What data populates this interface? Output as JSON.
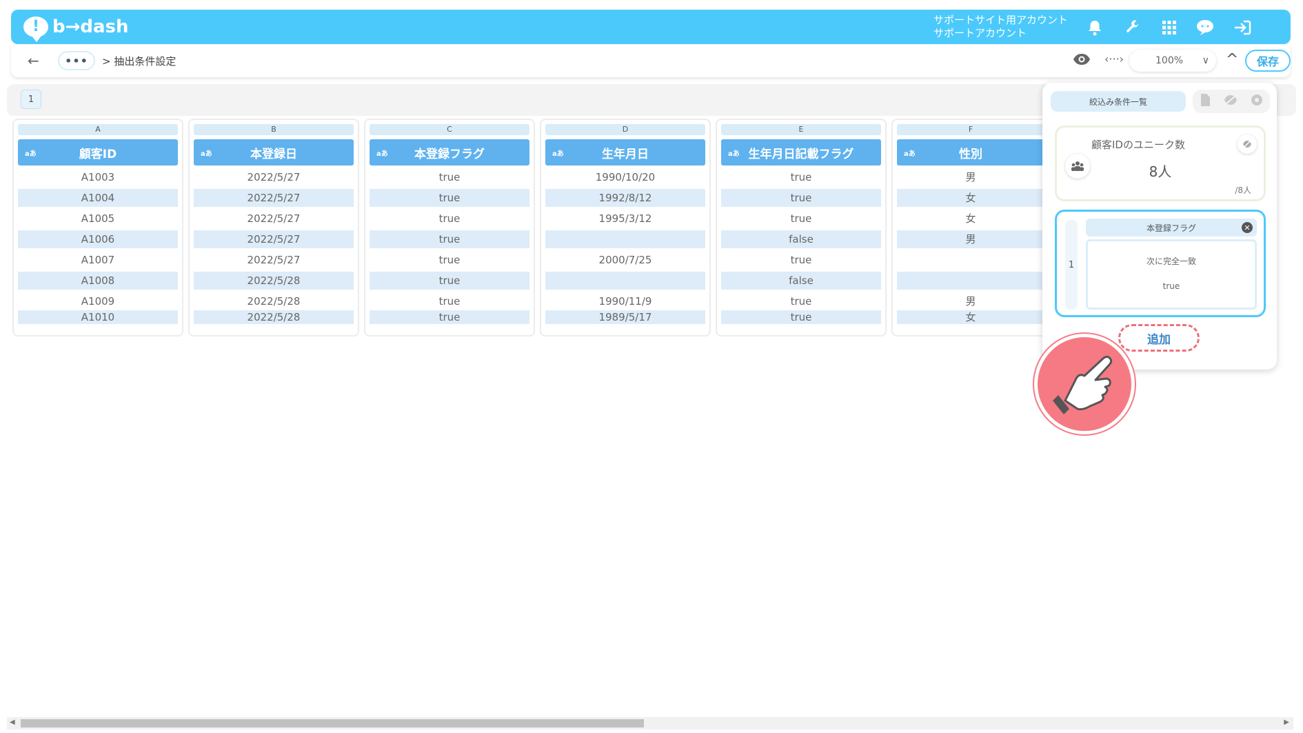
{
  "header": {
    "logo_text": "b→dash",
    "logo_mark": "!",
    "account_line1": "サポートサイト用アカウント",
    "account_line2": "サポートアカウント",
    "icons": [
      "bell-icon",
      "wrench-icon",
      "grid-icon",
      "chat-icon",
      "logout-icon"
    ],
    "brand_color": "#4cc9fb"
  },
  "toolbar": {
    "back": "←",
    "more": "•••",
    "breadcrumb": "> 抽出条件設定",
    "code_icon": "‹···›",
    "zoom": "100%",
    "zoom_caret": "∨",
    "collapse": "^",
    "save_label": "保存"
  },
  "sheet": {
    "page_tab": "1"
  },
  "columns": [
    {
      "letter": "A",
      "type": "aあ",
      "header": "顧客ID",
      "cells": [
        "A1003",
        "A1004",
        "A1005",
        "A1006",
        "A1007",
        "A1008",
        "A1009",
        "A1010"
      ]
    },
    {
      "letter": "B",
      "type": "aあ",
      "header": "本登録日",
      "cells": [
        "2022/5/27",
        "2022/5/27",
        "2022/5/27",
        "2022/5/27",
        "2022/5/27",
        "2022/5/28",
        "2022/5/28",
        "2022/5/28"
      ]
    },
    {
      "letter": "C",
      "type": "aあ",
      "header": "本登録フラグ",
      "cells": [
        "true",
        "true",
        "true",
        "true",
        "true",
        "true",
        "true",
        "true"
      ]
    },
    {
      "letter": "D",
      "type": "aあ",
      "header": "生年月日",
      "cells": [
        "1990/10/20",
        "1992/8/12",
        "1995/3/12",
        "",
        "2000/7/25",
        "",
        "1990/11/9",
        "1989/5/17"
      ]
    },
    {
      "letter": "E",
      "type": "aあ",
      "header": "生年月日記載フラグ",
      "cells": [
        "true",
        "true",
        "true",
        "false",
        "true",
        "false",
        "true",
        "true"
      ]
    },
    {
      "letter": "F",
      "type": "aあ",
      "header": "性別",
      "cells": [
        "男",
        "女",
        "女",
        "男",
        "",
        "",
        "男",
        "女"
      ]
    }
  ],
  "panel": {
    "tab_label": "絞込み条件一覧",
    "unique_title": "顧客IDのユニーク数",
    "unique_value": "8人",
    "unique_total": "/8人",
    "condition_index": "1",
    "condition_field": "本登録フラグ",
    "condition_operator": "次に完全一致",
    "condition_value": "true",
    "add_label": "追加"
  }
}
